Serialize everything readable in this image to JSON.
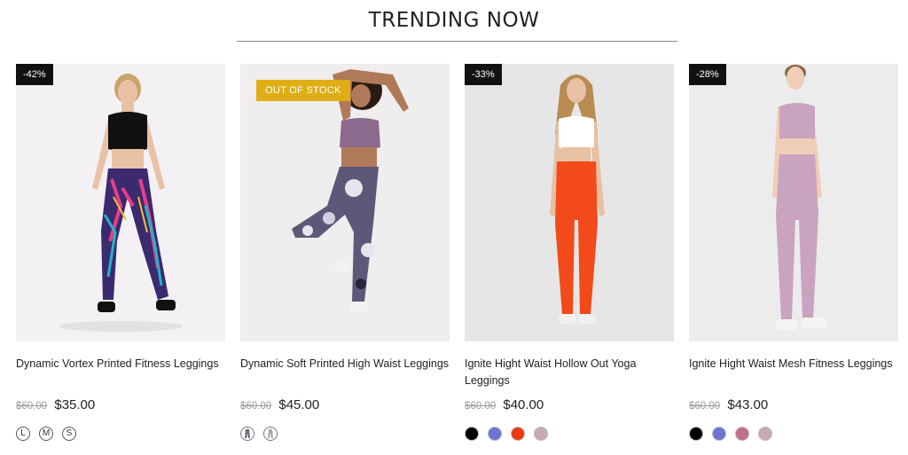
{
  "section": {
    "title": "TRENDING NOW"
  },
  "products": [
    {
      "badge": "-42%",
      "badge_type": "discount",
      "name": "Dynamic Vortex Printed Fitness Leggings",
      "old_price": "$60.00",
      "price": "$35.00",
      "options": [
        {
          "type": "size",
          "label": "L"
        },
        {
          "type": "size",
          "label": "M"
        },
        {
          "type": "size",
          "label": "S"
        }
      ],
      "image": {
        "top": "#111111",
        "bottom": "#3b2a6e",
        "bg": "#f2f0f2",
        "skin": "#e9c2a6",
        "hair": "#c9a46a"
      }
    },
    {
      "badge": "OUT OF STOCK",
      "badge_type": "stock",
      "name": "Dynamic Soft Printed High Waist Leggings",
      "old_price": "$60.00",
      "price": "$45.00",
      "options": [
        {
          "type": "pattern",
          "label": "pattern-1"
        },
        {
          "type": "pattern",
          "label": "pattern-2"
        }
      ],
      "image": {
        "top": "#8b6a8e",
        "bottom": "#5e5878",
        "bg": "#efeded",
        "skin": "#b07a5a",
        "hair": "#2a1a14"
      }
    },
    {
      "badge": "-33%",
      "badge_type": "discount",
      "name": "Ignite Hight Waist Hollow Out Yoga Leggings",
      "old_price": "$60.00",
      "price": "$40.00",
      "options": [
        {
          "type": "color",
          "label": "#000000"
        },
        {
          "type": "color",
          "label": "#6d74d3"
        },
        {
          "type": "color",
          "label": "#ee3a12"
        },
        {
          "type": "color",
          "label": "#c9a8b6"
        }
      ],
      "image": {
        "top": "#ffffff",
        "bottom": "#f24a1a",
        "bg": "#e6e6e6",
        "skin": "#e8c0a2",
        "hair": "#b98a52"
      }
    },
    {
      "badge": "-28%",
      "badge_type": "discount",
      "name": "Ignite Hight Waist Mesh Fitness Leggings",
      "old_price": "$60.00",
      "price": "$43.00",
      "options": [
        {
          "type": "color",
          "label": "#000000"
        },
        {
          "type": "color",
          "label": "#6d74d3"
        },
        {
          "type": "color",
          "label": "#c46e8e"
        },
        {
          "type": "color",
          "label": "#c9a8b6"
        }
      ],
      "image": {
        "top": "#c9a3bf",
        "bottom": "#c9a3bf",
        "bg": "#ececec",
        "skin": "#efcdb6",
        "hair": "#8a6a4a"
      }
    }
  ]
}
